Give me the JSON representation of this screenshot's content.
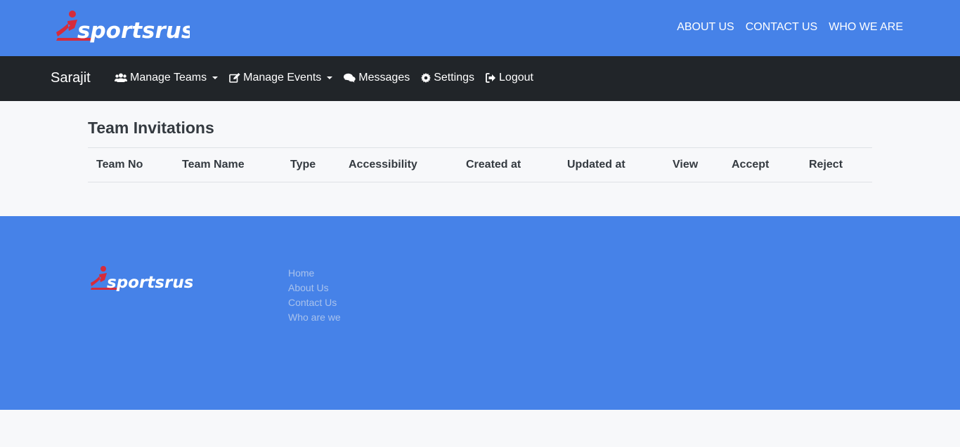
{
  "header": {
    "logo_text": "sportsrush",
    "links": [
      "ABOUT US",
      "CONTACT US",
      "WHO WE ARE"
    ]
  },
  "navbar": {
    "brand": "Sarajit",
    "items": [
      {
        "label": "Manage Teams",
        "icon": "users-icon",
        "dropdown": true
      },
      {
        "label": "Manage Events",
        "icon": "edit-icon",
        "dropdown": true
      },
      {
        "label": "Messages",
        "icon": "comments-icon",
        "dropdown": false
      },
      {
        "label": "Settings",
        "icon": "gear-icon",
        "dropdown": false
      },
      {
        "label": "Logout",
        "icon": "sign-out-icon",
        "dropdown": false
      }
    ]
  },
  "main": {
    "title": "Team Invitations",
    "columns": [
      "Team No",
      "Team Name",
      "Type",
      "Accessibility",
      "Created at",
      "Updated at",
      "View",
      "Accept",
      "Reject"
    ],
    "rows": []
  },
  "footer": {
    "logo_text": "sportsrush",
    "links": [
      "Home",
      "About Us",
      "Contact Us",
      "Who are we"
    ]
  },
  "colors": {
    "brand_blue": "#4682e8",
    "navbar_dark": "#212529",
    "logo_red": "#d62b3b",
    "footer_link": "#a9c2ec"
  }
}
